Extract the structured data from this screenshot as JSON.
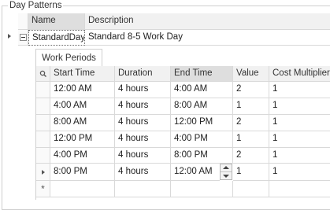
{
  "group_title": "Day Patterns",
  "master": {
    "columns": [
      "Name",
      "Description"
    ],
    "row": {
      "name": "StandardDay",
      "description": "Standard 8-5 Work Day"
    }
  },
  "detail": {
    "tab": "Work Periods",
    "columns": [
      "Start Time",
      "Duration",
      "End Time",
      "Value",
      "Cost Multiplier"
    ],
    "rows": [
      [
        "12:00 AM",
        "4 hours",
        "4:00 AM",
        "2",
        "1"
      ],
      [
        "4:00 AM",
        "4 hours",
        "8:00 AM",
        "1",
        "1"
      ],
      [
        "8:00 AM",
        "4 hours",
        "12:00 PM",
        "2",
        "1"
      ],
      [
        "12:00 PM",
        "4 hours",
        "4:00 PM",
        "1",
        "1"
      ],
      [
        "4:00 PM",
        "4 hours",
        "8:00 PM",
        "2",
        "1"
      ],
      [
        "8:00 PM",
        "4 hours",
        "12:00 AM",
        "1",
        "1"
      ]
    ],
    "new_row_glyph": "*"
  },
  "icons": {
    "search": "search-icon",
    "collapse": "collapse-icon",
    "row_pointer": "row-pointer-icon",
    "spin": "spin-icon"
  },
  "colors": {
    "header_bg": "#f1f1f1",
    "selected_header_bg": "#dedede",
    "grid_line": "#d9d9d9"
  }
}
